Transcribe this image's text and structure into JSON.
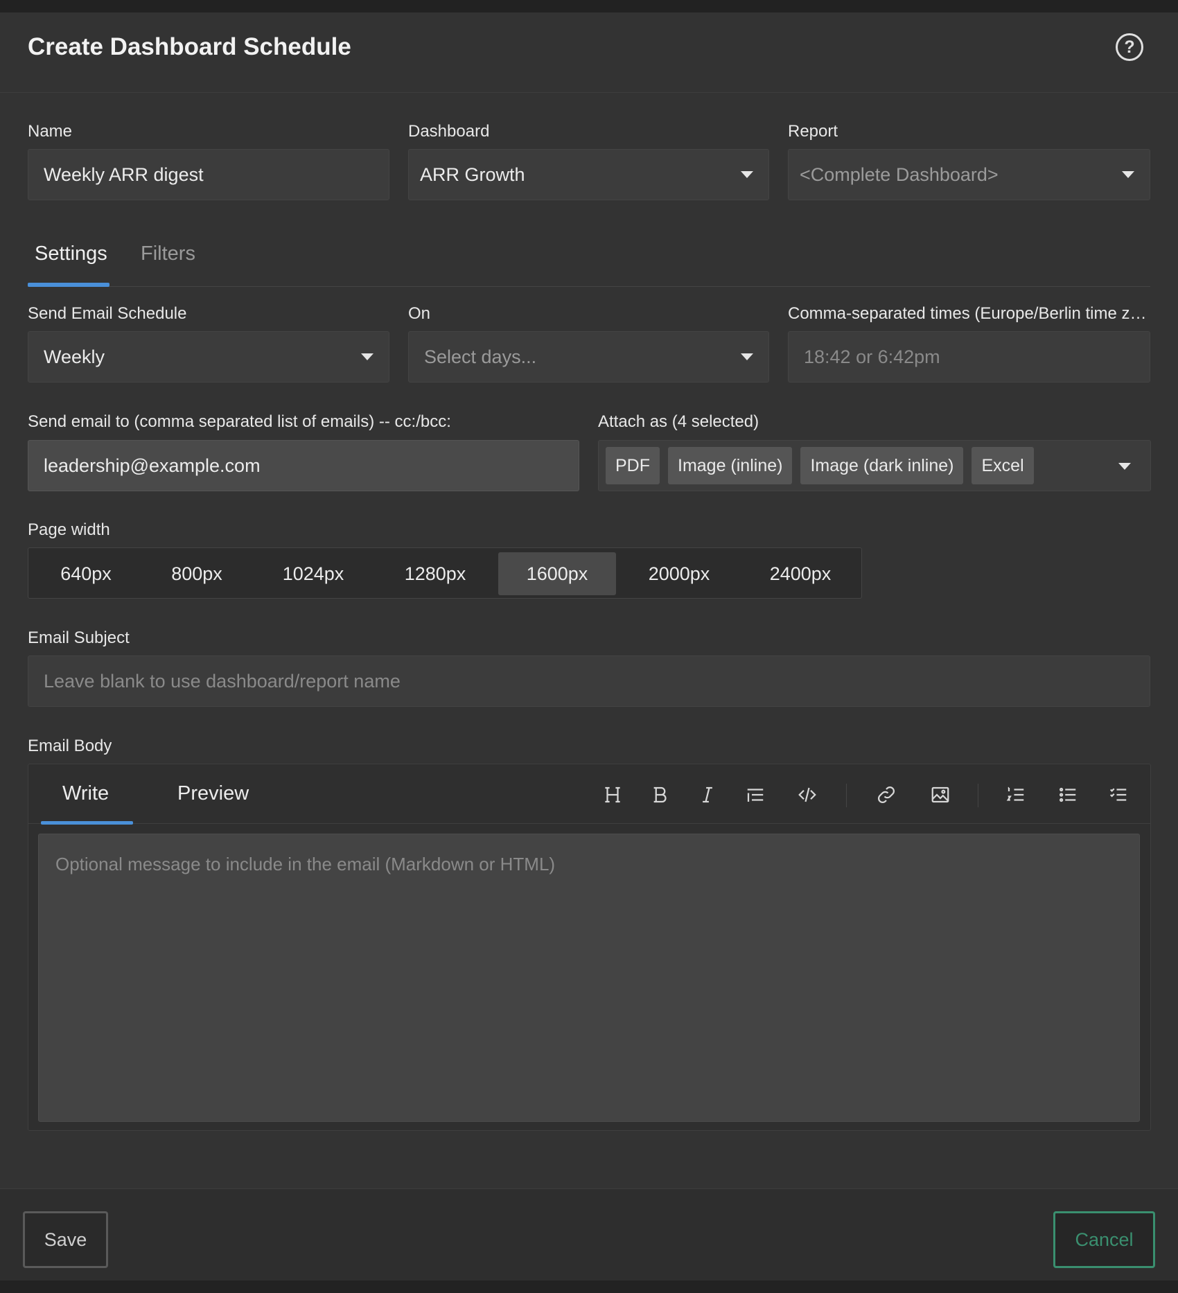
{
  "title": "Create Dashboard Schedule",
  "icons": {
    "help": "help-circle-icon",
    "dropdown": "caret-down-icon"
  },
  "colors": {
    "accent_tab": "#4a90d9",
    "cancel": "#3a8f6f",
    "background": "#333333"
  },
  "name": {
    "label": "Name",
    "value": "Weekly ARR digest"
  },
  "dashboard": {
    "label": "Dashboard",
    "value": "ARR Growth"
  },
  "report": {
    "label": "Report",
    "value": "<Complete Dashboard>"
  },
  "tabs": {
    "settings": "Settings",
    "filters": "Filters",
    "active": "Settings"
  },
  "schedule": {
    "label": "Send Email Schedule",
    "value": "Weekly"
  },
  "on": {
    "label": "On",
    "placeholder": "Select days..."
  },
  "times": {
    "label": "Comma-separated times (Europe/Berlin time zo...",
    "placeholder": "18:42 or 6:42pm"
  },
  "recipients": {
    "label": "Send email to (comma separated list of emails) -- cc:/bcc:",
    "value": "leadership@example.com"
  },
  "attach": {
    "label": "Attach as (4 selected)",
    "chips": [
      "PDF",
      "Image (inline)",
      "Image (dark inline)",
      "Excel"
    ]
  },
  "page_width": {
    "label": "Page width",
    "options": [
      "640px",
      "800px",
      "1024px",
      "1280px",
      "1600px",
      "2000px",
      "2400px"
    ],
    "selected": "1600px"
  },
  "subject": {
    "label": "Email Subject",
    "placeholder": "Leave blank to use dashboard/report name"
  },
  "body": {
    "label": "Email Body",
    "tab_write": "Write",
    "tab_preview": "Preview",
    "active_tab": "Write",
    "placeholder": "Optional message to include in the email (Markdown or HTML)",
    "toolbar": [
      "heading-icon",
      "bold-icon",
      "italic-icon",
      "quote-icon",
      "code-icon",
      "link-icon",
      "image-icon",
      "ordered-list-icon",
      "unordered-list-icon",
      "task-list-icon"
    ]
  },
  "footer": {
    "save_label": "Save",
    "cancel_label": "Cancel"
  }
}
